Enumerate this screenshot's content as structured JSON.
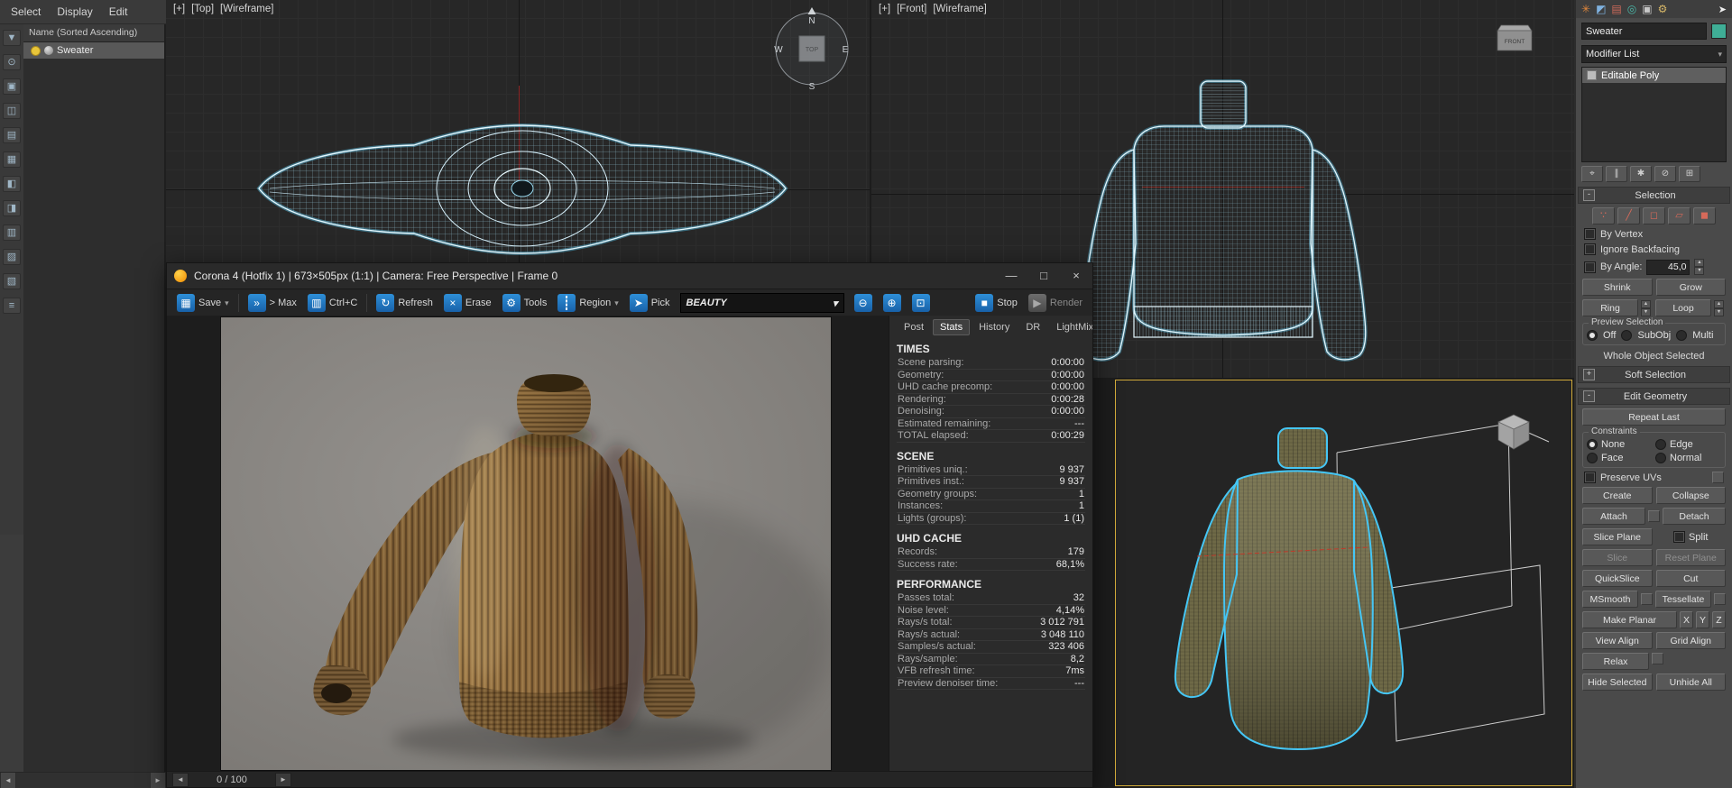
{
  "colors": {
    "accent_blue": "#1e79c8",
    "active_viewport_border": "#d2ab3a",
    "object_color_swatch": "#3fae96",
    "selection_outline": "#45c6f5",
    "wireframe": "#bfe6f7"
  },
  "icons": {
    "save": "▦",
    "to_max": "»",
    "copy": "▥",
    "refresh": "↻",
    "erase": "×",
    "tools": "⚙",
    "pick": "➤",
    "zoom_out": "⊖",
    "zoom_in": "⊕",
    "zoom_11": "⊡",
    "stop": "■",
    "render": "▶",
    "dropdown": "▾",
    "min": "—",
    "max": "□",
    "close": "×",
    "scroll_left": "◄",
    "scroll_right": "►",
    "sort": "▲",
    "rollout_open": "-",
    "rollout_closed": "+"
  },
  "menubar": {
    "items": [
      "Select",
      "Display",
      "Edit"
    ]
  },
  "explorer": {
    "header": "Name (Sorted Ascending)",
    "item": "Sweater",
    "tools": [
      "▼",
      "⊙",
      "▣",
      "◫",
      "▤",
      "▦",
      "◧",
      "◨",
      "▥",
      "▨",
      "▧",
      "≡"
    ]
  },
  "viewports": {
    "top": {
      "plus": "[+]",
      "view": "[Top]",
      "shading": "[Wireframe]"
    },
    "front": {
      "plus": "[+]",
      "view": "[Front]",
      "shading": "[Wireframe]"
    },
    "compass": {
      "n": "N",
      "e": "E",
      "s": "S",
      "w": "W",
      "cube": "TOP"
    },
    "front_cube": "FRONT"
  },
  "command_panel": {
    "tabs": [
      "✳",
      "◩",
      "▤",
      "◎",
      "▣",
      "⚙"
    ],
    "cursor": "➤",
    "object_name": "Sweater",
    "modifier_list": "Modifier List",
    "stack_item": "Editable Poly",
    "stack_tools": [
      "⌖",
      "∥",
      "✱",
      "⊘",
      "⊞"
    ],
    "subobject_tools": [
      "∵",
      "╱",
      "◻",
      "▱",
      "◼"
    ],
    "selection": {
      "title": "Selection",
      "by_vertex": "By Vertex",
      "ignore_backfacing": "Ignore Backfacing",
      "by_angle": "By Angle:",
      "by_angle_value": "45,0",
      "shrink": "Shrink",
      "grow": "Grow",
      "ring": "Ring",
      "loop": "Loop",
      "preview_title": "Preview Selection",
      "preview_options": [
        "Off",
        "SubObj",
        "Multi"
      ],
      "status": "Whole Object Selected"
    },
    "soft_selection_title": "Soft Selection",
    "edit_geometry": {
      "title": "Edit Geometry",
      "repeat_last": "Repeat Last",
      "constraints_title": "Constraints",
      "constraints": [
        "None",
        "Edge",
        "Face",
        "Normal"
      ],
      "preserve_uvs": "Preserve UVs",
      "create": "Create",
      "collapse": "Collapse",
      "attach": "Attach",
      "detach": "Detach",
      "slice_plane": "Slice Plane",
      "split": "Split",
      "slice": "Slice",
      "reset_plane": "Reset Plane",
      "quickslice": "QuickSlice",
      "cut": "Cut",
      "msmooth": "MSmooth",
      "tessellate": "Tessellate",
      "make_planar": "Make Planar",
      "axis_x": "X",
      "axis_y": "Y",
      "axis_z": "Z",
      "view_align": "View Align",
      "grid_align": "Grid Align",
      "relax": "Relax",
      "hide_selected": "Hide Selected",
      "unhide_all": "Unhide All"
    }
  },
  "vfb": {
    "title": "Corona 4 (Hotfix 1) | 673×505px (1:1) | Camera: Free Perspective | Frame 0",
    "toolbar": {
      "save": "Save",
      "to_max": "> Max",
      "copy": "Ctrl+C",
      "refresh": "Refresh",
      "erase": "Erase",
      "tools": "Tools",
      "region": "Region",
      "pick": "Pick",
      "pass": "BEAUTY",
      "stop": "Stop",
      "render": "Render"
    },
    "tabs": [
      "Post",
      "Stats",
      "History",
      "DR",
      "LightMix"
    ],
    "active_tab": "Stats",
    "stats": {
      "sections": {
        "times": {
          "title": "TIMES",
          "rows": [
            {
              "l": "Scene parsing:",
              "v": "0:00:00"
            },
            {
              "l": "Geometry:",
              "v": "0:00:00"
            },
            {
              "l": "UHD cache precomp:",
              "v": "0:00:00"
            },
            {
              "l": "Rendering:",
              "v": "0:00:28"
            },
            {
              "l": "Denoising:",
              "v": "0:00:00"
            },
            {
              "l": "Estimated remaining:",
              "v": "---"
            },
            {
              "l": "TOTAL elapsed:",
              "v": "0:00:29"
            }
          ]
        },
        "scene": {
          "title": "SCENE",
          "rows": [
            {
              "l": "Primitives uniq.:",
              "v": "9 937"
            },
            {
              "l": "Primitives inst.:",
              "v": "9 937"
            },
            {
              "l": "Geometry groups:",
              "v": "1"
            },
            {
              "l": "Instances:",
              "v": "1"
            },
            {
              "l": "Lights (groups):",
              "v": "1 (1)"
            }
          ]
        },
        "uhd": {
          "title": "UHD CACHE",
          "rows": [
            {
              "l": "Records:",
              "v": "179"
            },
            {
              "l": "Success rate:",
              "v": "68,1%"
            }
          ]
        },
        "performance": {
          "title": "PERFORMANCE",
          "rows": [
            {
              "l": "Passes total:",
              "v": "32"
            },
            {
              "l": "Noise level:",
              "v": "4,14%"
            },
            {
              "l": "Rays/s total:",
              "v": "3 012 791"
            },
            {
              "l": "Rays/s actual:",
              "v": "3 048 110"
            },
            {
              "l": "Samples/s actual:",
              "v": "323 406"
            },
            {
              "l": "Rays/sample:",
              "v": "8,2"
            },
            {
              "l": "VFB refresh time:",
              "v": "7ms"
            },
            {
              "l": "Preview denoiser time:",
              "v": "---"
            }
          ]
        }
      }
    },
    "progress": "0 / 100"
  }
}
